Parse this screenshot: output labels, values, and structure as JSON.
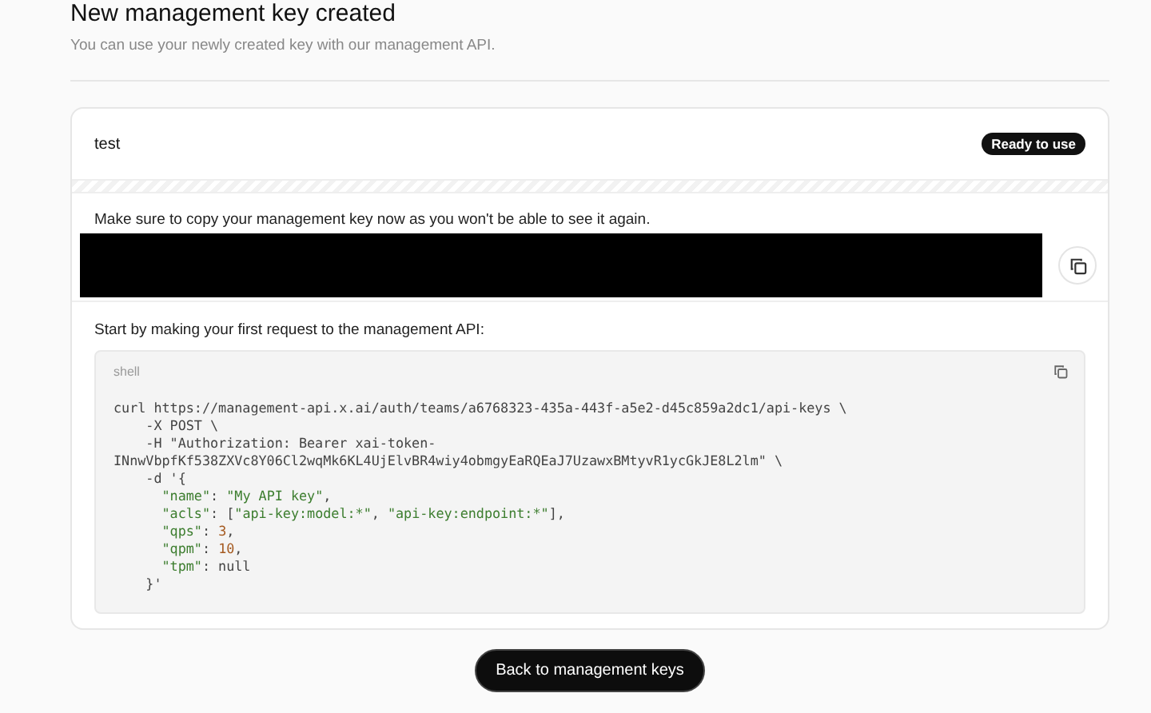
{
  "page": {
    "title": "New management key created",
    "subtitle": "You can use your newly created key with our management API."
  },
  "key_card": {
    "name": "test",
    "status": "Ready to use",
    "copy_notice": "Make sure to copy your management key now as you won't be able to see it again.",
    "intro": "Start by making your first request to the management API:",
    "code_block": {
      "language": "shell",
      "lines": [
        [
          {
            "kind": "plain",
            "text": "curl https://management-api.x.ai/auth/teams/a6768323-435a-443f-a5e2-d45c859a2dc1/api-keys \\"
          }
        ],
        [
          {
            "kind": "plain",
            "text": "    -X POST \\"
          }
        ],
        [
          {
            "kind": "plain",
            "text": "    -H \"Authorization: Bearer xai-token-"
          }
        ],
        [
          {
            "kind": "plain",
            "text": "INnwVbpfKf538ZXVc8Y06Cl2wqMk6KL4UjElvBR4wiy4obmgyEaRQEaJ7UzawxBMtyvR1ycGkJE8L2lm\" \\"
          }
        ],
        [
          {
            "kind": "plain",
            "text": "    -d '{"
          }
        ],
        [
          {
            "kind": "string",
            "text": "      \"name\""
          },
          {
            "kind": "plain",
            "text": ": "
          },
          {
            "kind": "string",
            "text": "\"My API key\""
          },
          {
            "kind": "plain",
            "text": ","
          }
        ],
        [
          {
            "kind": "string",
            "text": "      \"acls\""
          },
          {
            "kind": "plain",
            "text": ": ["
          },
          {
            "kind": "string",
            "text": "\"api-key:model:*\""
          },
          {
            "kind": "plain",
            "text": ", "
          },
          {
            "kind": "string",
            "text": "\"api-key:endpoint:*\""
          },
          {
            "kind": "plain",
            "text": "],"
          }
        ],
        [
          {
            "kind": "string",
            "text": "      \"qps\""
          },
          {
            "kind": "plain",
            "text": ": "
          },
          {
            "kind": "number",
            "text": "3"
          },
          {
            "kind": "plain",
            "text": ","
          }
        ],
        [
          {
            "kind": "string",
            "text": "      \"qpm\""
          },
          {
            "kind": "plain",
            "text": ": "
          },
          {
            "kind": "number",
            "text": "10"
          },
          {
            "kind": "plain",
            "text": ","
          }
        ],
        [
          {
            "kind": "string",
            "text": "      \"tpm\""
          },
          {
            "kind": "plain",
            "text": ": null"
          }
        ],
        [
          {
            "kind": "plain",
            "text": "    }'"
          }
        ]
      ]
    }
  },
  "back_button": "Back to management keys"
}
